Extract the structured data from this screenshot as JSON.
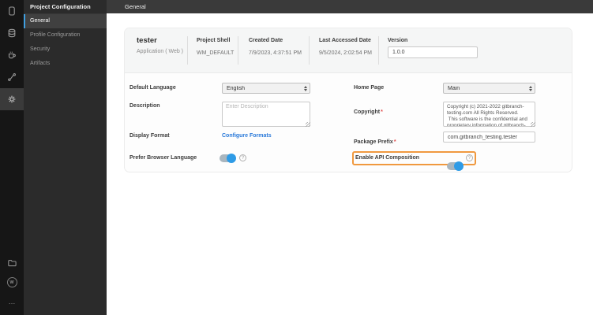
{
  "top_bar": {
    "title": "General"
  },
  "icon_rail": {
    "icons": [
      "mobile-icon",
      "database-icon",
      "coffee-icon",
      "flow-icon",
      "gear-icon"
    ],
    "bottom_icons": [
      "folder-icon",
      "wm-badge-icon",
      "more-icon"
    ],
    "wm_glyph": "W",
    "more_glyph": "…"
  },
  "sidebar": {
    "title": "Project Configuration",
    "items": [
      {
        "label": "General",
        "active": true
      },
      {
        "label": "Profile Configuration",
        "active": false
      },
      {
        "label": "Security",
        "active": false
      },
      {
        "label": "Artifacts",
        "active": false
      }
    ]
  },
  "project_card": {
    "name": "tester",
    "type": "Application ( Web )",
    "fields": [
      {
        "label": "Project Shell",
        "value": "WM_DEFAULT"
      },
      {
        "label": "Created Date",
        "value": "7/9/2023, 4:37:51 PM"
      },
      {
        "label": "Last Accessed Date",
        "value": "9/5/2024, 2:02:54 PM"
      }
    ],
    "version": {
      "label": "Version",
      "value": "1.0.0"
    }
  },
  "form": {
    "required_mark": "*",
    "help_glyph": "?",
    "default_language": {
      "label": "Default Language",
      "value": "English"
    },
    "home_page": {
      "label": "Home Page",
      "value": "Main"
    },
    "description": {
      "label": "Description",
      "placeholder": "Enter Description",
      "value": ""
    },
    "copyright": {
      "label": "Copyright",
      "required": true,
      "value": "Copyright (c) 2021-2022 gitbranch-\ntesting.com All Rights Reserved.\n This software is the confidential and\nproprietary information of gitbranch-\ntesting.com"
    },
    "display_format": {
      "label": "Display Format",
      "link": "Configure Formats"
    },
    "package_prefix": {
      "label": "Package Prefix",
      "required": true,
      "value": "com.gitbranch_testing.tester"
    },
    "prefer_browser_language": {
      "label": "Prefer Browser Language",
      "on": true
    },
    "enable_api_composition": {
      "label": "Enable API Composition",
      "on": true,
      "highlighted": true
    }
  },
  "colors": {
    "accent_blue": "#2e9be6",
    "active_border_blue": "#3f9fe0",
    "link_blue": "#2979d9",
    "highlight_orange": "#f0993f",
    "required_red": "#e24c4c",
    "rail_dark": "#161616",
    "sidebar_dark": "#2b2b2b",
    "topbar_dark": "#3a3a3a",
    "info_section_gray": "#f5f6f6"
  }
}
